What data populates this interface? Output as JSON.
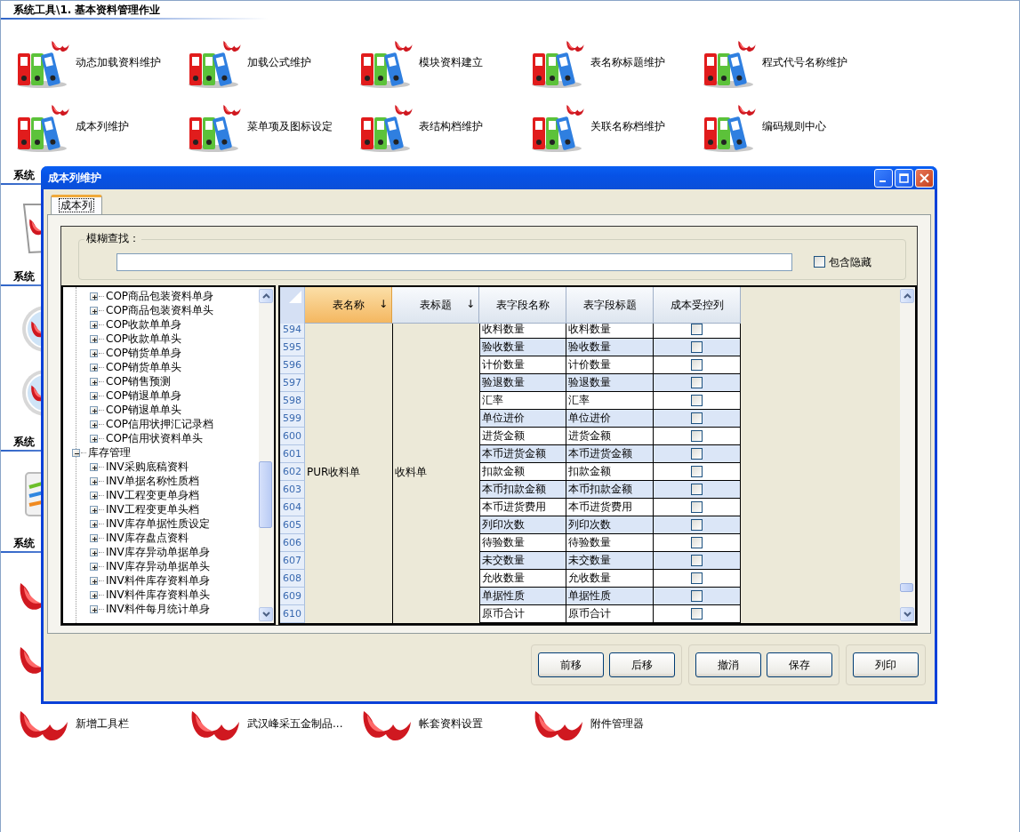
{
  "sections": [
    {
      "title": "系统工具\\1. 基本资料管理作业",
      "rows": [
        [
          {
            "kind": "binders",
            "label": "动态加载资料维护"
          },
          {
            "kind": "binders",
            "label": "加载公式维护"
          },
          {
            "kind": "binders",
            "label": "模块资料建立"
          },
          {
            "kind": "binders",
            "label": "表名称标题维护"
          },
          {
            "kind": "binders",
            "label": "程式代号名称维护"
          }
        ],
        [
          {
            "kind": "binders",
            "label": "成本列维护"
          },
          {
            "kind": "binders",
            "label": "菜单项及图标设定"
          },
          {
            "kind": "binders",
            "label": "表结构档维护"
          },
          {
            "kind": "binders",
            "label": "关联名称档维护"
          },
          {
            "kind": "binders",
            "label": "编码规则中心"
          }
        ]
      ]
    },
    {
      "title": "系统",
      "rows": [
        [
          {
            "kind": "document"
          }
        ]
      ]
    },
    {
      "title": "系统",
      "rows": [
        [
          {
            "kind": "clock"
          }
        ],
        [
          {
            "kind": "clock"
          }
        ]
      ]
    },
    {
      "title": "系统",
      "rows": [
        [
          {
            "kind": "chart"
          }
        ]
      ]
    },
    {
      "title": "系统",
      "rows": [
        [
          {
            "kind": "logo"
          }
        ],
        [
          {
            "kind": "logo"
          }
        ],
        [
          {
            "kind": "logo",
            "label": "新增工具栏"
          },
          {
            "kind": "logo",
            "label": "武汉峰采五金制品..."
          },
          {
            "kind": "logo",
            "label": "帐套资料设置"
          },
          {
            "kind": "logo",
            "label": "附件管理器"
          }
        ]
      ]
    }
  ],
  "dialog": {
    "title": "成本列维护",
    "tabs": [
      {
        "label": "成本列",
        "selected": true
      }
    ],
    "search": {
      "label": "模糊查找："
    },
    "include_hidden": {
      "label": "包含隐藏",
      "checked": false
    },
    "tree": [
      {
        "children": [
          {
            "label": "COP商品包装资料单身",
            "expanded": false
          },
          {
            "label": "COP商品包装资料单头",
            "expanded": false
          },
          {
            "label": "COP收款单单身",
            "expanded": false
          },
          {
            "label": "COP收款单单头",
            "expanded": false
          },
          {
            "label": "COP销货单单身",
            "expanded": false
          },
          {
            "label": "COP销货单单头",
            "expanded": false
          },
          {
            "label": "COP销售预测",
            "expanded": false
          },
          {
            "label": "COP销退单单身",
            "expanded": false
          },
          {
            "label": "COP销退单单头",
            "expanded": false
          },
          {
            "label": "COP信用状押汇记录档",
            "expanded": false
          },
          {
            "label": "COP信用状资料单头",
            "expanded": false
          }
        ]
      },
      {
        "label": "库存管理",
        "expanded": true,
        "children": [
          {
            "label": "INV采购底稿资料",
            "expanded": false
          },
          {
            "label": "INV单据名称性质档",
            "expanded": false
          },
          {
            "label": "INV工程变更单身档",
            "expanded": false
          },
          {
            "label": "INV工程变更单头档",
            "expanded": false
          },
          {
            "label": "INV库存单据性质设定",
            "expanded": false
          },
          {
            "label": "INV库存盘点资料",
            "expanded": false
          },
          {
            "label": "INV库存异动单据单身",
            "expanded": false
          },
          {
            "label": "INV库存异动单据单头",
            "expanded": false
          },
          {
            "label": "INV料件库存资料单身",
            "expanded": false
          },
          {
            "label": "INV料件库存资料单头",
            "expanded": false
          },
          {
            "label": "INV料件每月统计单身",
            "expanded": false
          }
        ]
      }
    ],
    "grid": {
      "columns": [
        {
          "label": "表名称",
          "sort_arrow": "↓",
          "selected": true
        },
        {
          "label": "表标题",
          "sort_arrow": "↓",
          "selected": false
        },
        {
          "label": "表字段名称",
          "selected": false
        },
        {
          "label": "表字段标题",
          "selected": false
        },
        {
          "label": "成本受控列",
          "selected": false
        }
      ],
      "table_name": "PUR收料单",
      "table_title": "收料单",
      "rows": [
        {
          "number": "594",
          "field_name": "收料数量",
          "field_title": "收料数量",
          "checked": false
        },
        {
          "number": "595",
          "field_name": "验收数量",
          "field_title": "验收数量",
          "checked": false
        },
        {
          "number": "596",
          "field_name": "计价数量",
          "field_title": "计价数量",
          "checked": false
        },
        {
          "number": "597",
          "field_name": "验退数量",
          "field_title": "验退数量",
          "checked": false
        },
        {
          "number": "598",
          "field_name": "汇率",
          "field_title": "汇率",
          "checked": false
        },
        {
          "number": "599",
          "field_name": "单位进价",
          "field_title": "单位进价",
          "checked": false
        },
        {
          "number": "600",
          "field_name": "进货金额",
          "field_title": "进货金额",
          "checked": false
        },
        {
          "number": "601",
          "field_name": "本币进货金额",
          "field_title": "本币进货金额",
          "checked": false
        },
        {
          "number": "602",
          "field_name": "扣款金额",
          "field_title": "扣款金额",
          "checked": false
        },
        {
          "number": "603",
          "field_name": "本币扣款金额",
          "field_title": "本币扣款金额",
          "checked": false
        },
        {
          "number": "604",
          "field_name": "本币进货费用",
          "field_title": "本币进货费用",
          "checked": false
        },
        {
          "number": "605",
          "field_name": "列印次数",
          "field_title": "列印次数",
          "checked": false
        },
        {
          "number": "606",
          "field_name": "待验数量",
          "field_title": "待验数量",
          "checked": false
        },
        {
          "number": "607",
          "field_name": "未交数量",
          "field_title": "未交数量",
          "checked": false
        },
        {
          "number": "608",
          "field_name": "允收数量",
          "field_title": "允收数量",
          "checked": false
        },
        {
          "number": "609",
          "field_name": "单据性质",
          "field_title": "单据性质",
          "checked": false
        },
        {
          "number": "610",
          "field_name": "原币合计",
          "field_title": "原币合计",
          "checked": false
        }
      ]
    },
    "button_groups": [
      [
        "前移",
        "后移"
      ],
      [
        "撤消",
        "保存"
      ],
      [
        "列印"
      ]
    ]
  }
}
